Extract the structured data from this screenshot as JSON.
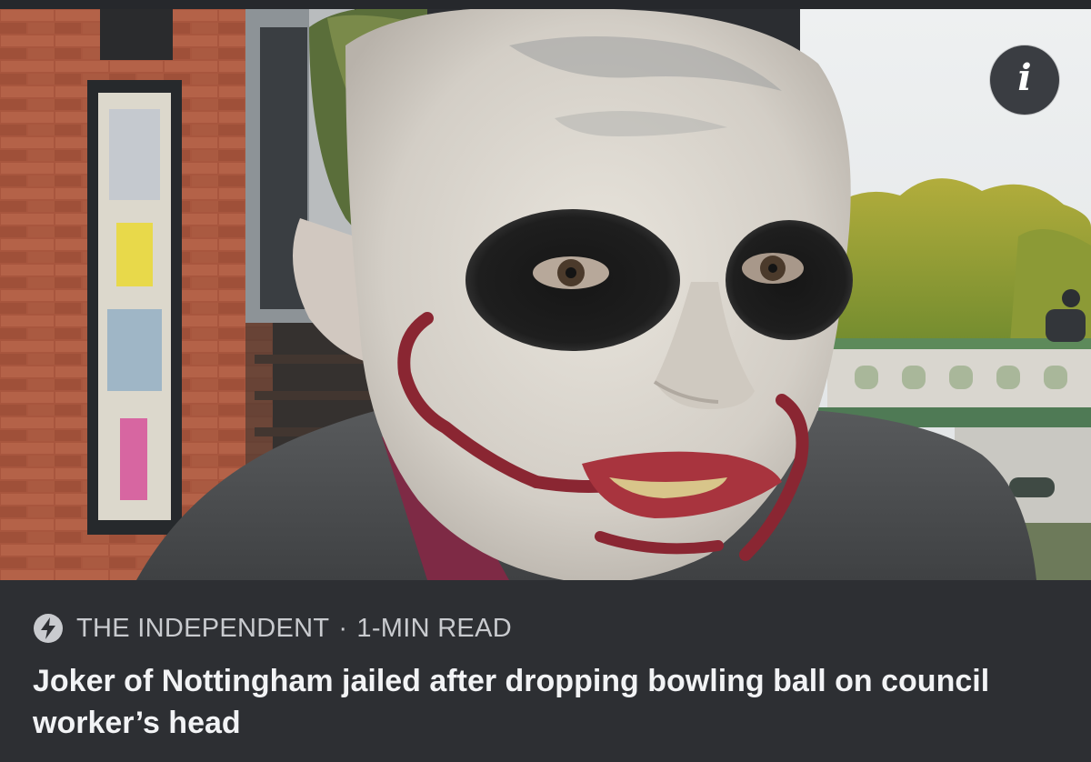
{
  "article": {
    "source": "THE INDEPENDENT",
    "separator": "·",
    "read_time": "1-MIN READ",
    "headline": "Joker of Nottingham jailed after dropping bowling ball on council worker’s head",
    "info_icon": "info-icon",
    "source_icon": "lightning-bolt-icon",
    "photo": "man-in-joker-face-paint"
  },
  "colors": {
    "meta_background": "#2d2f33",
    "meta_text": "#c9cbcf",
    "headline_text": "#f2f3f5",
    "info_button": "#3a3d42"
  }
}
